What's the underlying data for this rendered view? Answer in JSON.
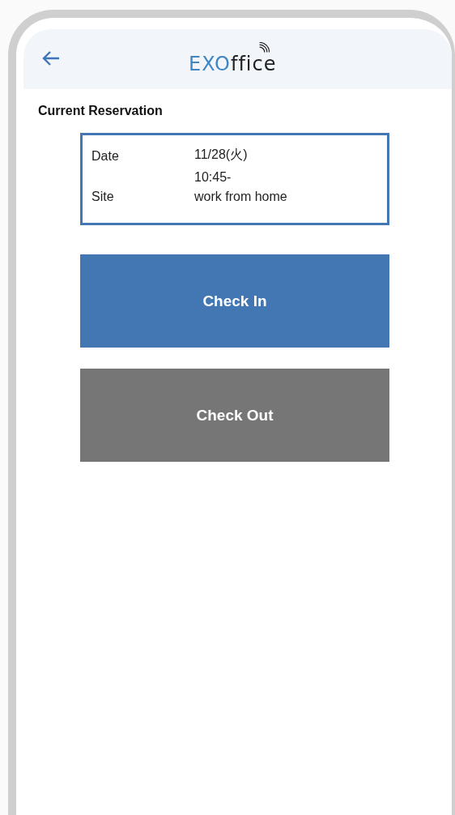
{
  "header": {
    "logo": {
      "lead": "EXO",
      "rest": "ffice"
    }
  },
  "section_title": "Current Reservation",
  "reservation": [
    {
      "label": "Date",
      "values": [
        "11/28(火)",
        "10:45-"
      ]
    },
    {
      "label": "Site",
      "values": [
        "work from home"
      ]
    }
  ],
  "buttons": [
    {
      "label": "Check In",
      "kind": "primary"
    },
    {
      "label": "Check Out",
      "kind": "secondary"
    }
  ]
}
